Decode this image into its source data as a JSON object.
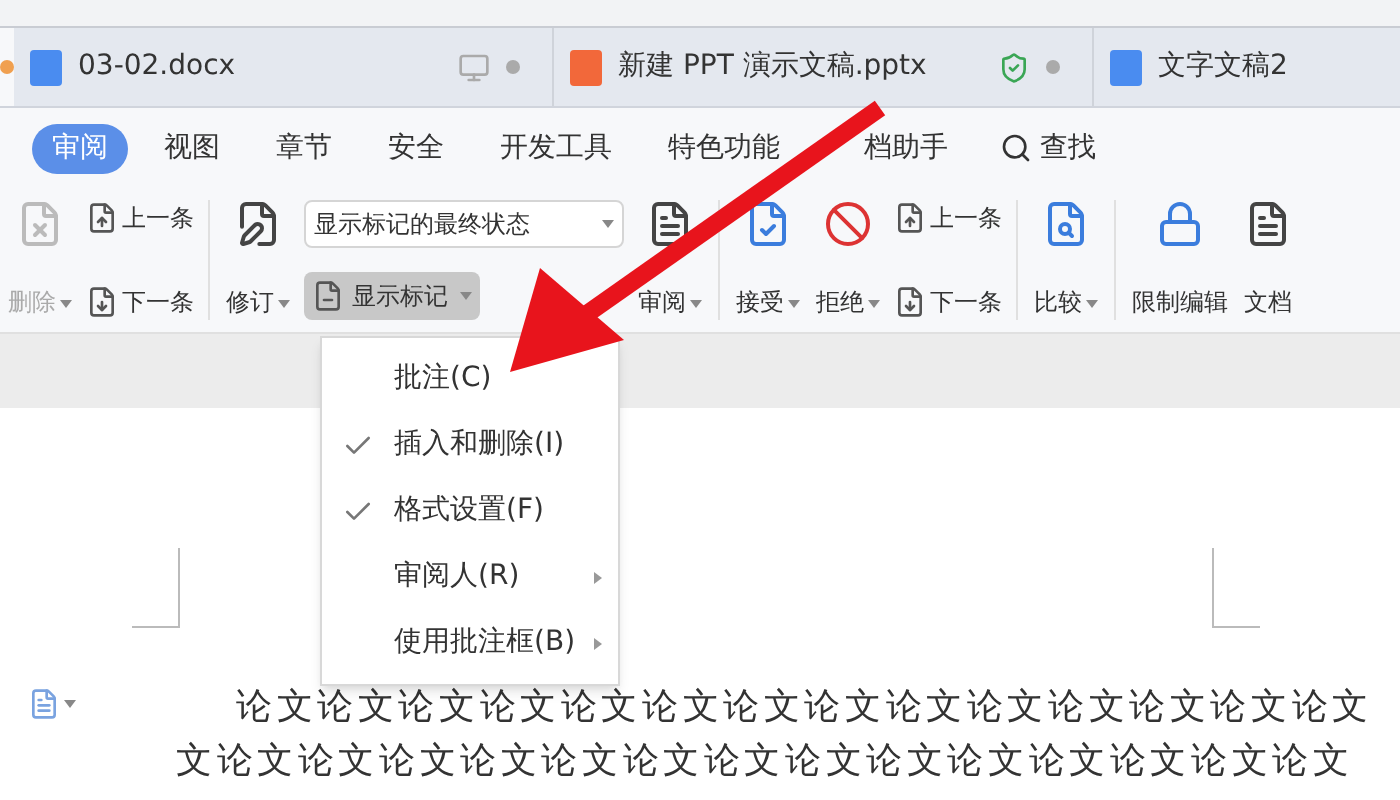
{
  "doc_tabs": [
    {
      "label": "03-02.docx",
      "kind": "document",
      "selected": false
    },
    {
      "label": "新建 PPT 演示文稿.pptx",
      "kind": "presentation",
      "selected": false
    },
    {
      "label": "文字文稿2",
      "kind": "document",
      "selected": false
    }
  ],
  "ribbon_tabs": [
    {
      "label": "审阅",
      "selected": true
    },
    {
      "label": "视图",
      "selected": false
    },
    {
      "label": "章节",
      "selected": false
    },
    {
      "label": "安全",
      "selected": false
    },
    {
      "label": "开发工具",
      "selected": false
    },
    {
      "label": "特色功能",
      "selected": false
    },
    {
      "label": "档助手",
      "selected": false
    }
  ],
  "search": {
    "label": "查找"
  },
  "toolbar": [
    {
      "kind": "dropdown",
      "label": "删除",
      "disabled": true
    },
    {
      "kind": "pair",
      "items": [
        "上一条",
        "下一条"
      ]
    },
    {
      "kind": "separator"
    },
    {
      "kind": "dropdown",
      "label": "修订",
      "disabled": false
    },
    {
      "kind": "markup",
      "value": "显示标记的最终状态",
      "button": "显示标记",
      "pressed": true
    },
    {
      "kind": "dropdown",
      "label": "审阅",
      "disabled": false
    },
    {
      "kind": "separator"
    },
    {
      "kind": "dropdown",
      "label": "接受",
      "disabled": false
    },
    {
      "kind": "dropdown",
      "label": "拒绝",
      "disabled": false
    },
    {
      "kind": "pair",
      "items": [
        "上一条",
        "下一条"
      ]
    },
    {
      "kind": "separator"
    },
    {
      "kind": "dropdown",
      "label": "比较",
      "disabled": false
    },
    {
      "kind": "separator"
    },
    {
      "kind": "button",
      "label": "限制编辑",
      "disabled": false
    },
    {
      "kind": "button",
      "label": "文档",
      "disabled": false
    }
  ],
  "menu": [
    {
      "kind": "check",
      "label": "批注(C)",
      "checked": false
    },
    {
      "kind": "check",
      "label": "插入和删除(I)",
      "checked": true
    },
    {
      "kind": "check",
      "label": "格式设置(F)",
      "checked": true
    },
    {
      "kind": "submenu",
      "label": "审阅人(R)"
    },
    {
      "kind": "submenu",
      "label": "使用批注框(B)"
    }
  ],
  "document": {
    "lines": [
      "论文论文论文论文论文论文论文论文论文论文论文论文论文论文",
      "文论文论文论文论文论文论文论文论文论文论文论文论文论文论文"
    ]
  }
}
